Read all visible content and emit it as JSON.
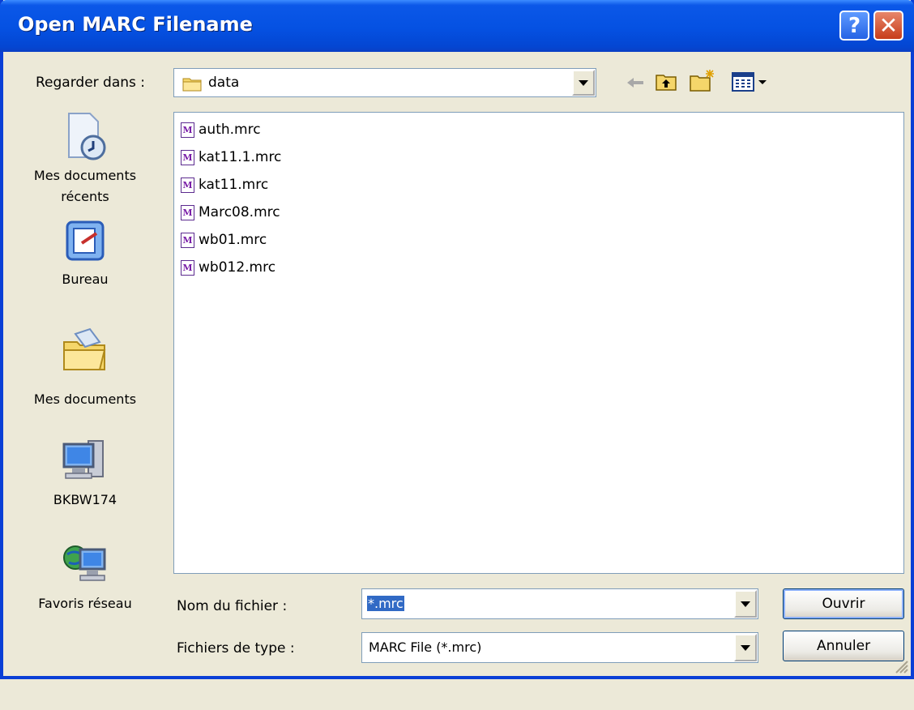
{
  "window": {
    "title": "Open MARC Filename"
  },
  "titlebar": {
    "help": "?",
    "close": "✕"
  },
  "look_in": {
    "label": "Regarder dans :",
    "value": "data"
  },
  "places": [
    {
      "label": "Mes documents récents",
      "icon": "recent-documents-icon"
    },
    {
      "label": "Bureau",
      "icon": "desktop-icon"
    },
    {
      "label": "Mes documents",
      "icon": "my-documents-icon"
    },
    {
      "label": "BKBW174",
      "icon": "computer-icon"
    },
    {
      "label": "Favoris réseau",
      "icon": "network-icon"
    }
  ],
  "files": [
    {
      "name": "auth.mrc"
    },
    {
      "name": "kat11.1.mrc"
    },
    {
      "name": "kat11.mrc"
    },
    {
      "name": "Marc08.mrc"
    },
    {
      "name": "wb01.mrc"
    },
    {
      "name": "wb012.mrc"
    }
  ],
  "file_icon_letter": "M",
  "filename": {
    "label": "Nom du fichier :",
    "value": "*.mrc"
  },
  "filetype": {
    "label": "Fichiers de type :",
    "value": "MARC File (*.mrc)"
  },
  "buttons": {
    "open": "Ouvrir",
    "cancel": "Annuler"
  }
}
